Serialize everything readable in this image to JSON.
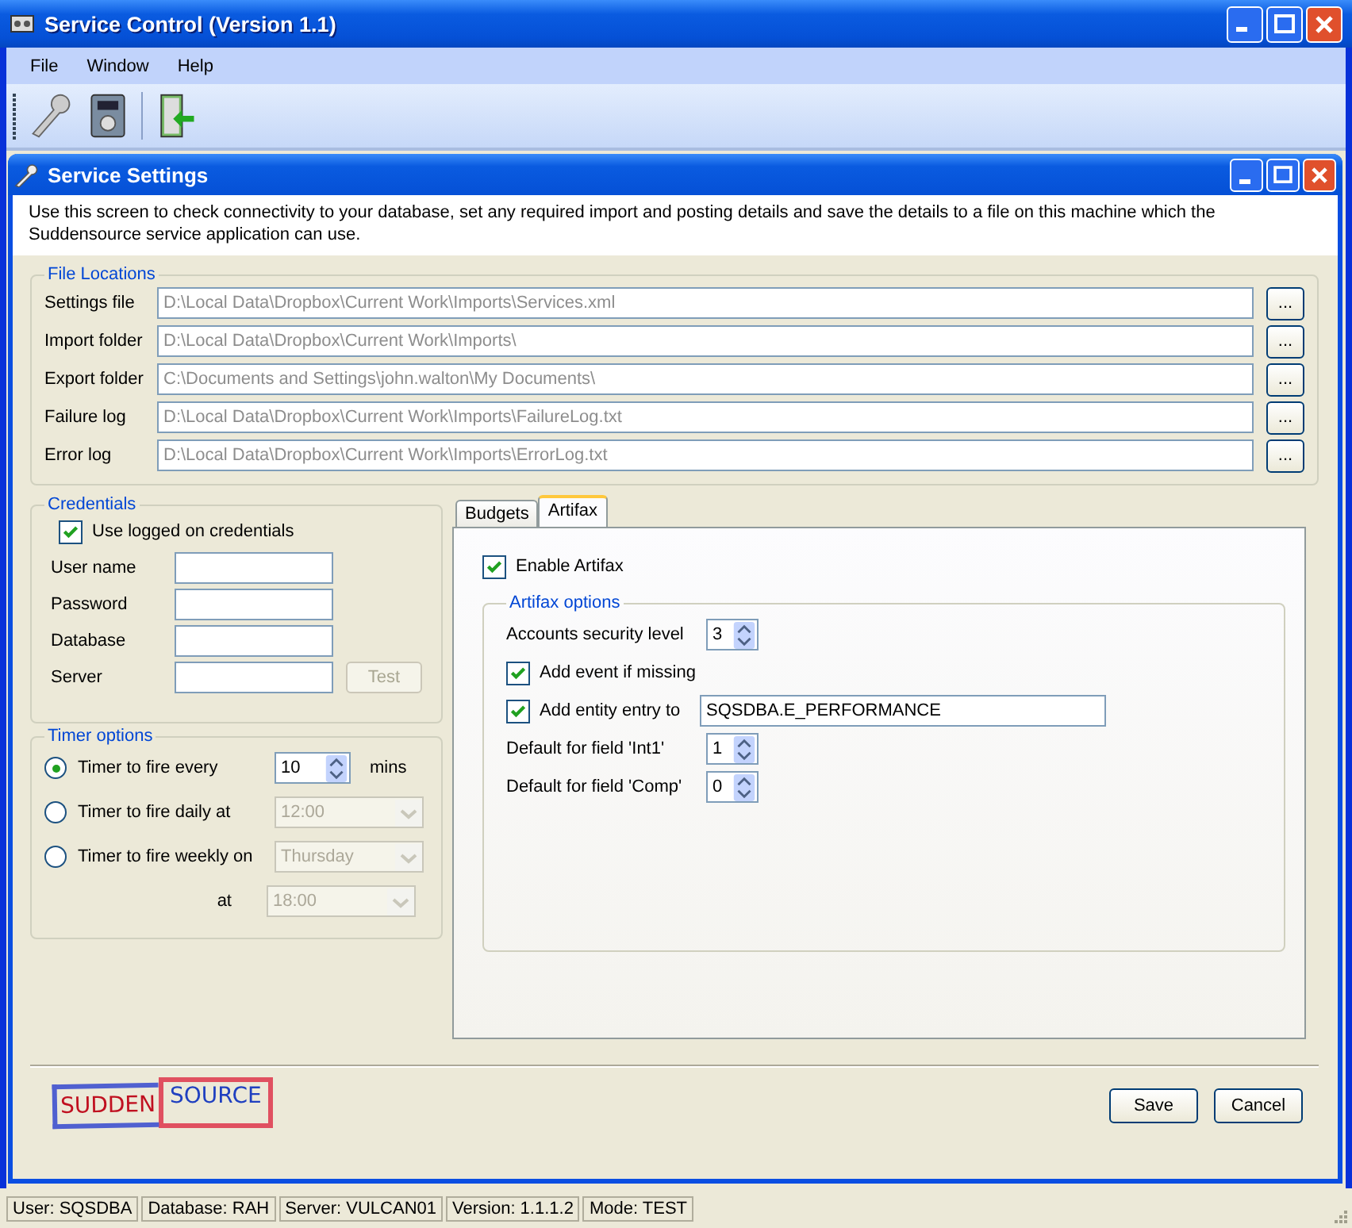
{
  "window": {
    "title": "Service Control (Version 1.1)"
  },
  "menu": [
    "File",
    "Window",
    "Help"
  ],
  "child_window": {
    "title": "Service Settings",
    "description": "Use this screen to check connectivity to your database, set any required import and posting details and save the details to a file on this machine which the Suddensource service application can use."
  },
  "file_locations": {
    "title": "File Locations",
    "browse_label": "...",
    "rows": [
      {
        "label": "Settings file",
        "value": "D:\\Local Data\\Dropbox\\Current Work\\Imports\\Services.xml",
        "disabled": true
      },
      {
        "label": "Import folder",
        "value": "D:\\Local Data\\Dropbox\\Current Work\\Imports\\",
        "disabled": true
      },
      {
        "label": "Export folder",
        "value": "C:\\Documents and Settings\\john.walton\\My Documents\\",
        "disabled": true
      },
      {
        "label": "Failure log",
        "value": "D:\\Local Data\\Dropbox\\Current Work\\Imports\\FailureLog.txt",
        "disabled": true
      },
      {
        "label": "Error log",
        "value": "D:\\Local Data\\Dropbox\\Current Work\\Imports\\ErrorLog.txt",
        "disabled": true
      }
    ]
  },
  "credentials": {
    "title": "Credentials",
    "use_logged_on": {
      "label": "Use logged on credentials",
      "checked": true
    },
    "fields": [
      {
        "label": "User name"
      },
      {
        "label": "Password"
      },
      {
        "label": "Database"
      },
      {
        "label": "Server"
      }
    ],
    "test_button": {
      "label": "Test",
      "disabled": true
    }
  },
  "timer_options": {
    "title": "Timer options",
    "options": [
      {
        "kind": "spin",
        "label": "Timer to fire every",
        "selected": true,
        "value": "10",
        "unit": "mins"
      },
      {
        "kind": "dropdown",
        "label": "Timer to fire daily at",
        "selected": false,
        "value": "12:00"
      },
      {
        "kind": "dropdown",
        "label": "Timer to fire weekly on",
        "selected": false,
        "value": "Thursday"
      },
      {
        "kind": "sub_dropdown",
        "label": "at",
        "value": "18:00"
      }
    ]
  },
  "tabs": [
    {
      "label": "Budgets",
      "selected": false
    },
    {
      "label": "Artifax",
      "selected": true
    }
  ],
  "artifax": {
    "enable": {
      "label": "Enable Artifax",
      "checked": true
    },
    "options_title": "Artifax options",
    "rows": [
      {
        "kind": "spin",
        "label": "Accounts security level",
        "value": "3"
      },
      {
        "kind": "check",
        "label": "Add event if missing",
        "checked": true
      },
      {
        "kind": "check_text",
        "label": "Add entity entry to",
        "checked": true,
        "value": "SQSDBA.E_PERFORMANCE"
      },
      {
        "kind": "spin",
        "label": "Default for field 'Int1'",
        "value": "1"
      },
      {
        "kind": "spin",
        "label": "Default for field 'Comp'",
        "value": "0"
      }
    ]
  },
  "logo": {
    "left": "SUDDEN",
    "right": "SOURCE"
  },
  "buttons": [
    "Save",
    "Cancel"
  ],
  "status_bar": [
    "User: SQSDBA",
    "Database: RAH",
    "Server: VULCAN01",
    "Version: 1.1.1.2",
    "Mode: TEST"
  ]
}
